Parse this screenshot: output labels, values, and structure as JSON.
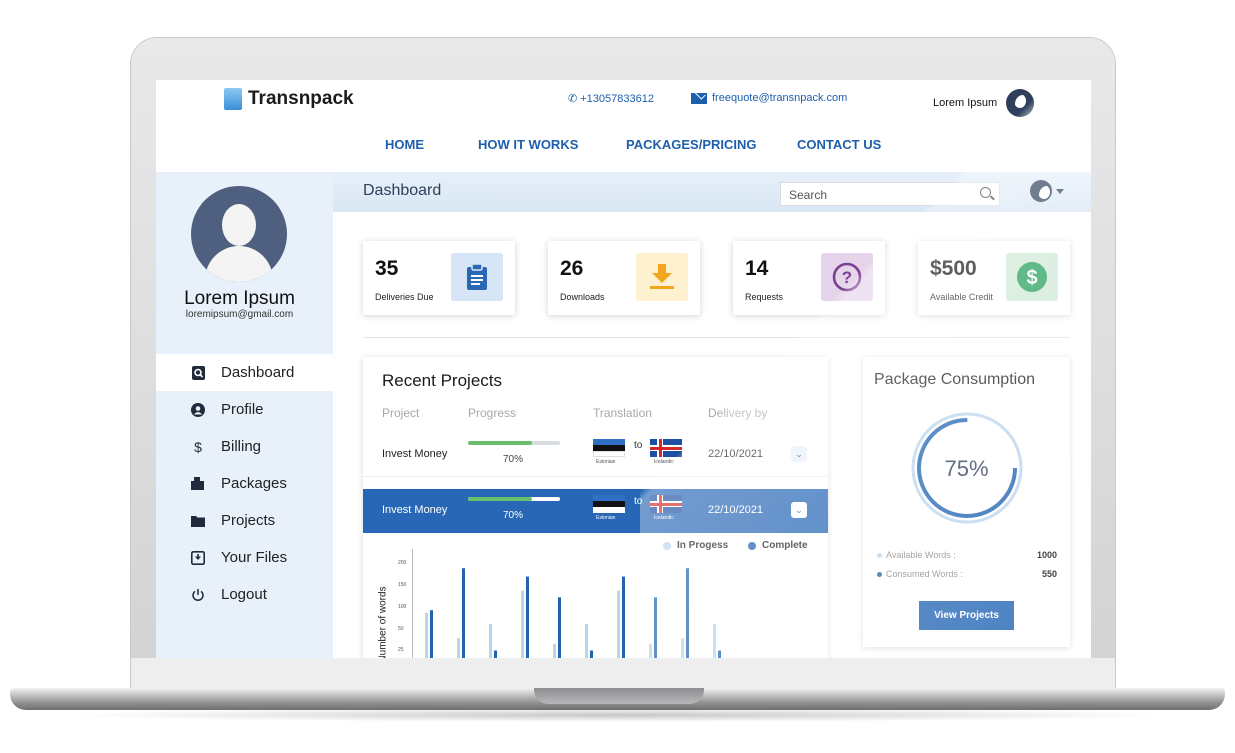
{
  "header": {
    "brand": "Transnpack",
    "phone": "+13057833612",
    "email": "freequote@transnpack.com",
    "user_name": "Lorem Ipsum"
  },
  "nav": [
    "HOME",
    "HOW IT WORKS",
    "PACKAGES/PRICING",
    "CONTACT US"
  ],
  "sidebar": {
    "name": "Lorem Ipsum",
    "email": "loremipsum@gmail.com",
    "items": [
      {
        "label": "Dashboard",
        "icon": "dashboard-icon"
      },
      {
        "label": "Profile",
        "icon": "user-icon"
      },
      {
        "label": "Billing",
        "icon": "dollar-icon"
      },
      {
        "label": "Packages",
        "icon": "package-icon"
      },
      {
        "label": "Projects",
        "icon": "folder-icon"
      },
      {
        "label": "Your Files",
        "icon": "download-box-icon"
      },
      {
        "label": "Logout",
        "icon": "power-icon"
      }
    ]
  },
  "main": {
    "title": "Dashboard",
    "search_placeholder": "Search"
  },
  "stats": [
    {
      "value": "35",
      "label": "Deliveries Due",
      "icon": "clipboard-icon",
      "bg": "#d6e6f7",
      "fg": "#2a67b5"
    },
    {
      "value": "26",
      "label": "Downloads",
      "icon": "download-icon",
      "bg": "#fdf1cf",
      "fg": "#f3a51e"
    },
    {
      "value": "14",
      "label": "Requests",
      "icon": "question-icon",
      "bg": "#e5d4ea",
      "fg": "#7b3f93"
    },
    {
      "value": "$500",
      "label": "Available Credit",
      "icon": "dollar-circle-icon",
      "bg": "#cfe9d6",
      "fg": "#1f9d55"
    }
  ],
  "projects": {
    "title": "Recent Projects",
    "columns": [
      "Project",
      "Progress",
      "Translation",
      "Delivery by"
    ],
    "rows": [
      {
        "name": "Invest Money",
        "progress": 0.7,
        "progress_label": "70%",
        "from": "Estonian",
        "to_word": "to",
        "to": "Icelandic",
        "date": "22/10/2021",
        "selected": false
      },
      {
        "name": "Invest Money",
        "progress": 0.7,
        "progress_label": "70%",
        "from": "Estonian",
        "to_word": "to",
        "to": "Icelandic",
        "date": "22/10/2021",
        "selected": true
      }
    ]
  },
  "chart_data": {
    "type": "bar",
    "ylabel": "Number of words",
    "ylim": [
      0,
      200
    ],
    "yticks": [
      "200",
      "150",
      "100",
      "50",
      "25"
    ],
    "series": [
      {
        "name": "In Progess",
        "color": "#b9d4ee",
        "values": [
          100,
          55,
          80,
          140,
          45,
          80,
          140,
          45,
          55,
          80
        ]
      },
      {
        "name": "Complete",
        "color": "#2063b0",
        "values": [
          105,
          180,
          33,
          165,
          128,
          33,
          165,
          128,
          180,
          33
        ]
      }
    ]
  },
  "package": {
    "title": "Package Consumption",
    "percent": 0.75,
    "percent_label": "75%",
    "available_label": "Available Words :",
    "available_value": "1000",
    "consumed_label": "Consumed Words :",
    "consumed_value": "550",
    "button": "View Projects"
  }
}
